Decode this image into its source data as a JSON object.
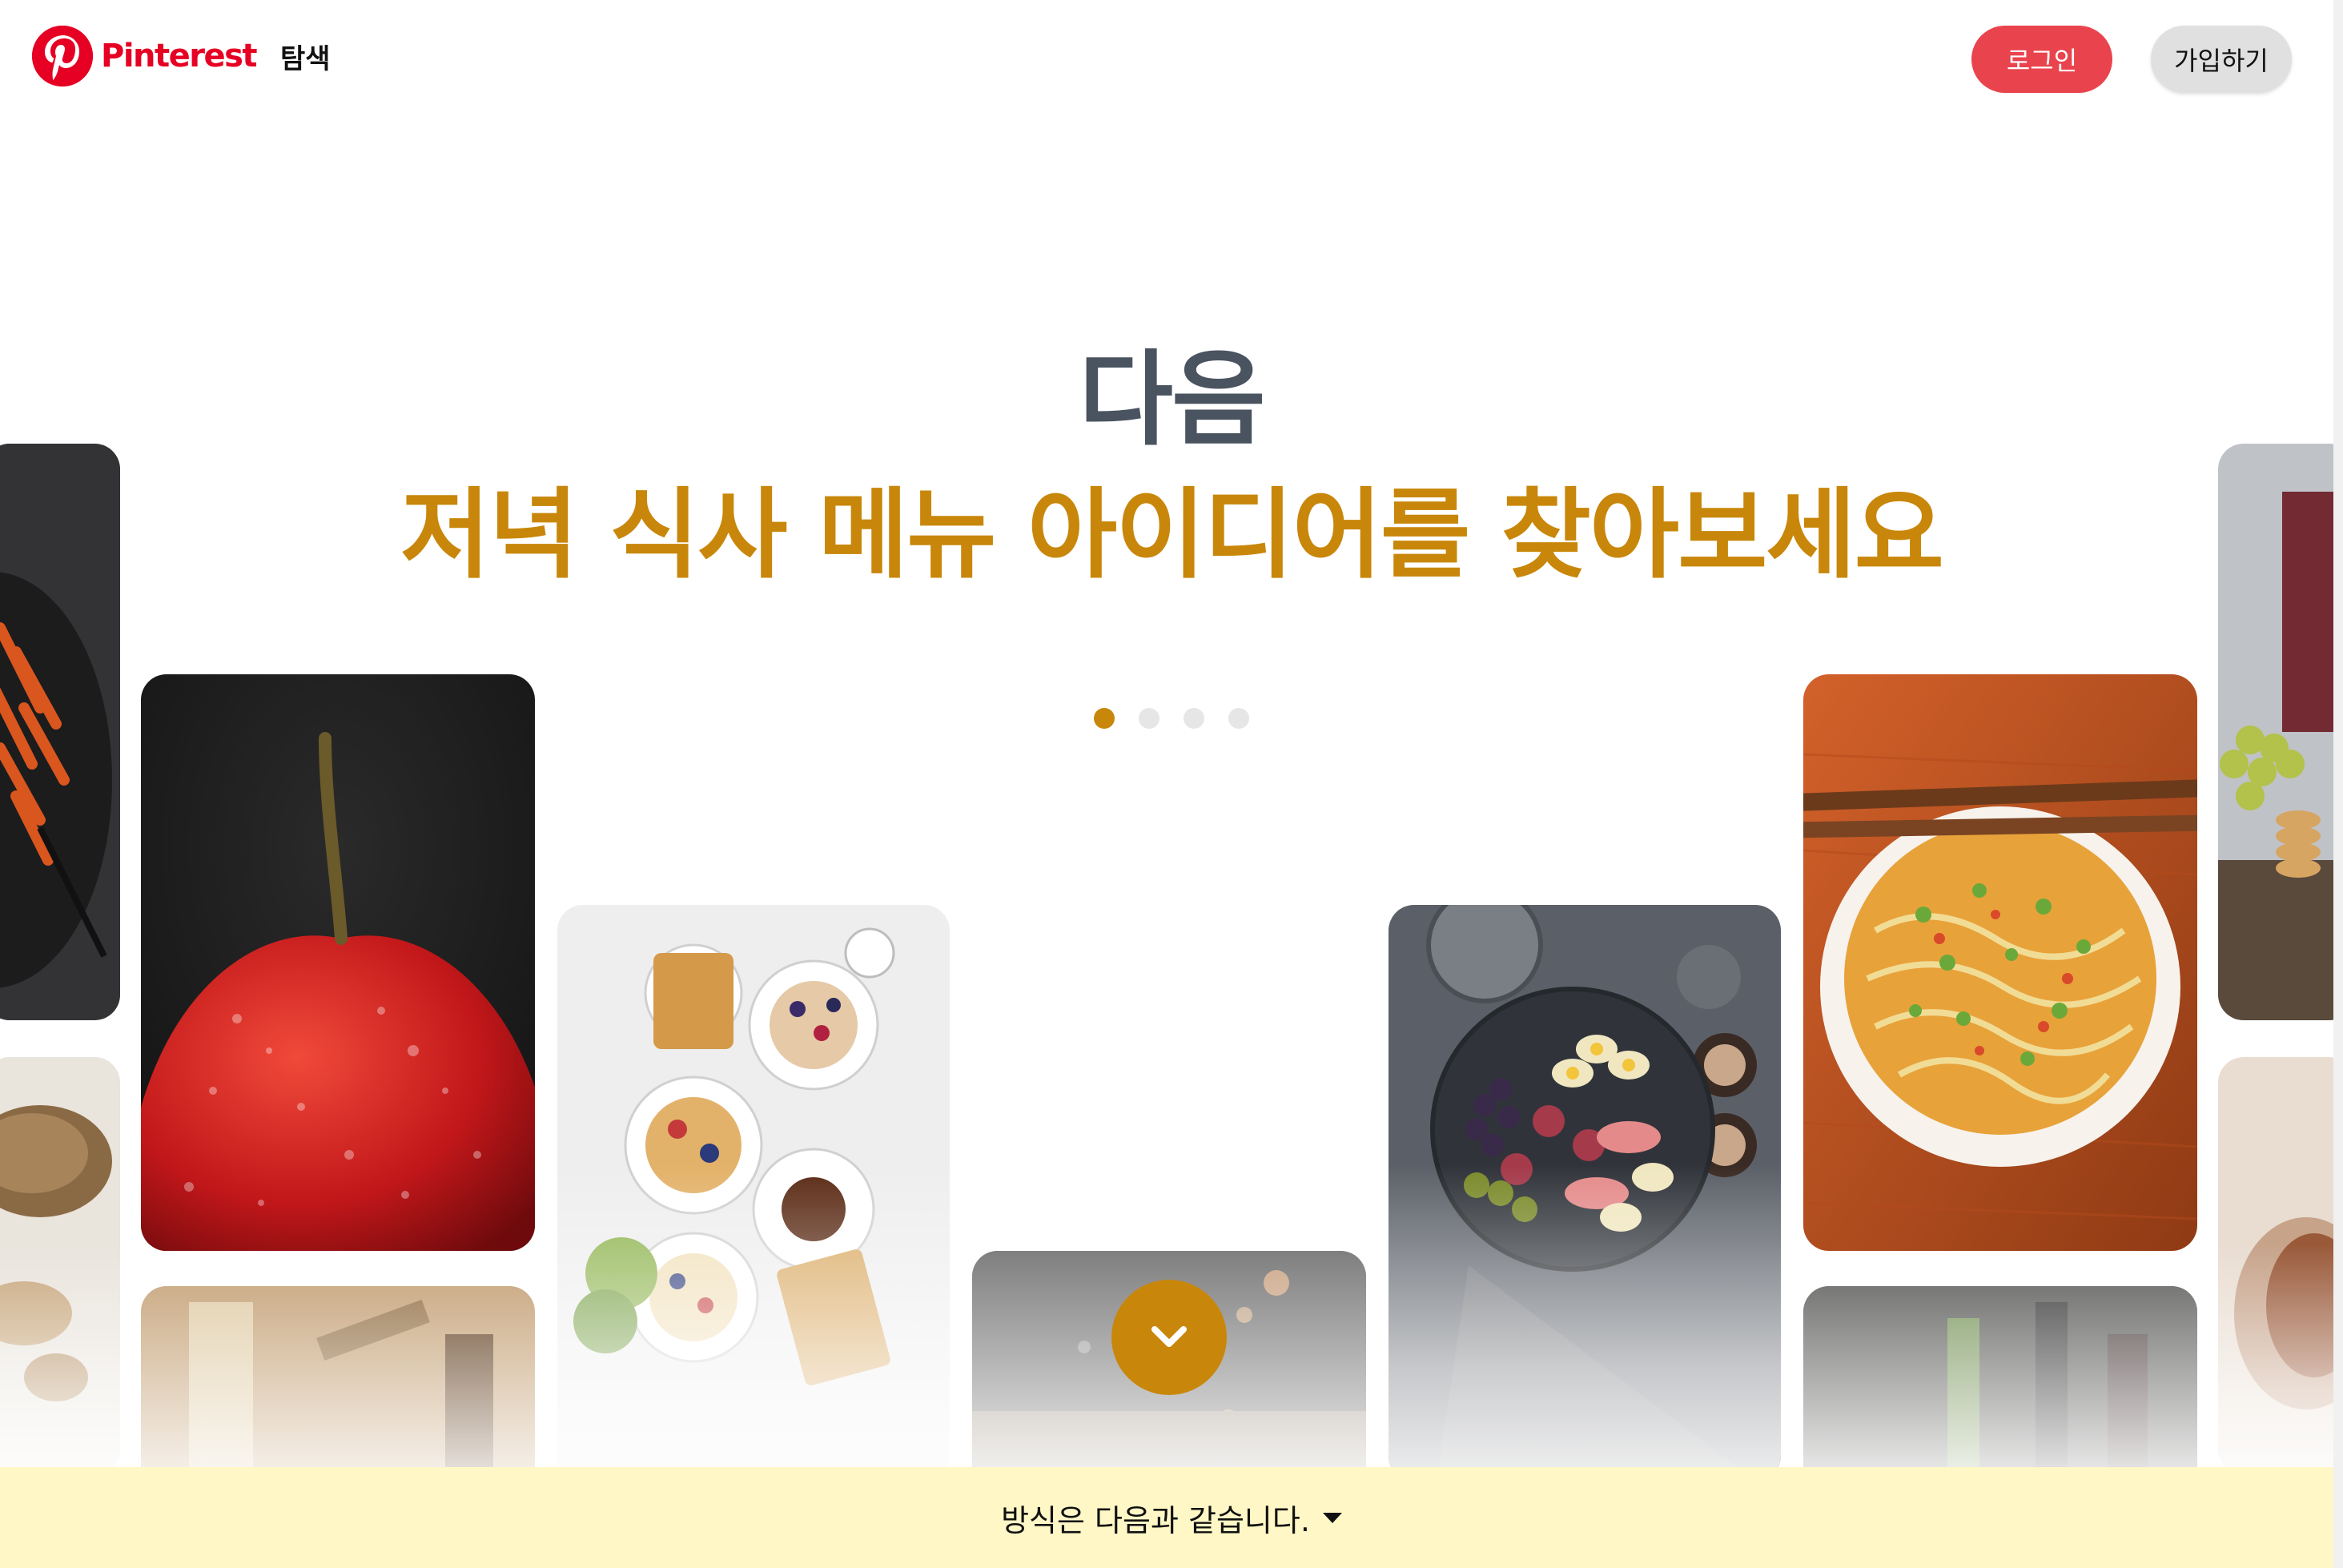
{
  "app": {
    "brand": "Pinterest"
  },
  "header": {
    "explore_label": "탐색",
    "login_label": "로그인",
    "signup_label": "가입하기"
  },
  "hero": {
    "line1": "다음",
    "line2": "저녁 식사 메뉴 아이디어를 찾아보세요",
    "carousel_dots": 4,
    "active_dot": 1
  },
  "footer_bar": {
    "label": "방식은 다음과 같습니다."
  },
  "colors": {
    "brand_red": "#e60023",
    "login_bg": "#e9444d",
    "accent_gold": "#c8870a",
    "heading_gray": "#4a5360",
    "footer_bg": "#fff7c6"
  },
  "icons": {
    "scroll_down": "chevron-down-icon",
    "footer_caret": "caret-down-icon"
  }
}
